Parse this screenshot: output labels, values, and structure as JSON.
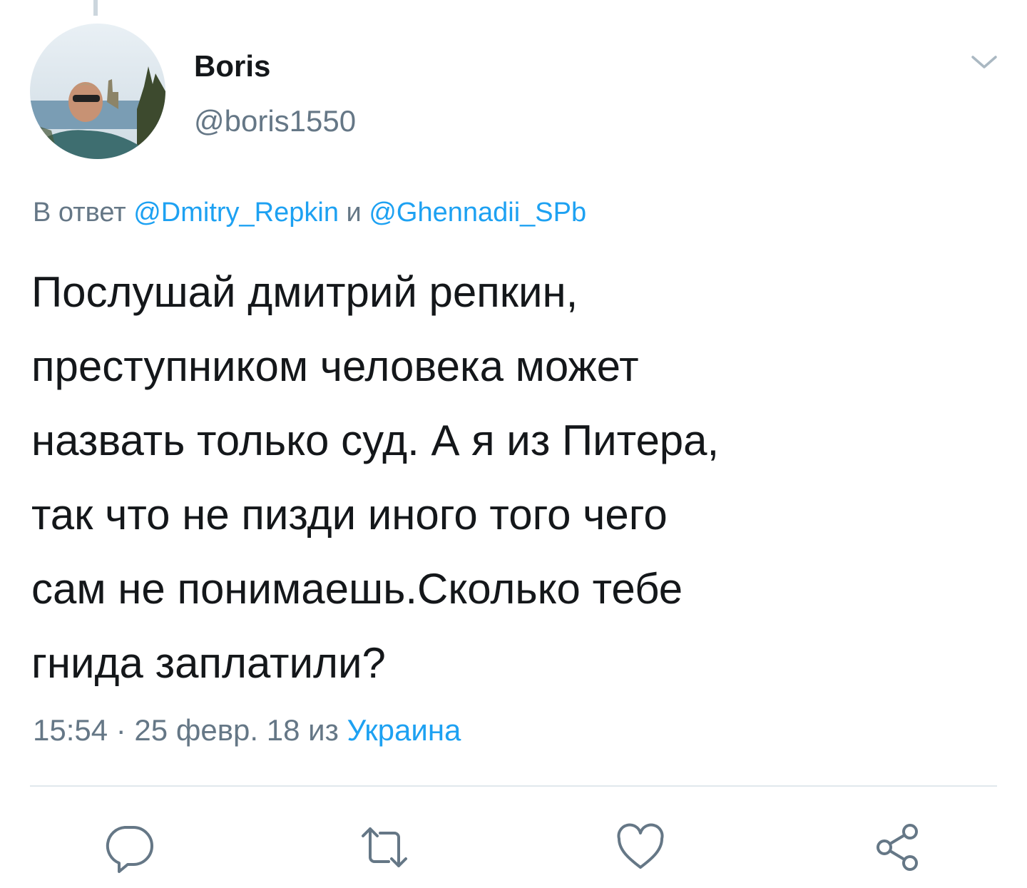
{
  "tweet": {
    "display_name": "Boris",
    "handle": "@boris1550",
    "reply_prefix": "В ответ",
    "reply_user_1": "@Dmitry_Repkin",
    "reply_conjunction": "и",
    "reply_user_2": "@Ghennadii_SPb",
    "text_lines": [
      "Послушай дмитрий репкин,",
      "преступником человека может",
      "назвать только суд. А я из Питера,",
      "так что не пизди иного того чего",
      "сам не понимаешь.Сколько тебе",
      "гнида заплатили?"
    ],
    "meta_time_date": "15:54 · 25 февр. 18",
    "meta_from": "из",
    "meta_location": "Украина"
  },
  "icons": {
    "menu": "chevron-down-icon",
    "reply": "reply-icon",
    "retweet": "retweet-icon",
    "like": "heart-icon",
    "share": "share-icon"
  },
  "colors": {
    "text": "#14171a",
    "secondary": "#657786",
    "link": "#1da1f2",
    "divider": "#e1e8ed"
  }
}
